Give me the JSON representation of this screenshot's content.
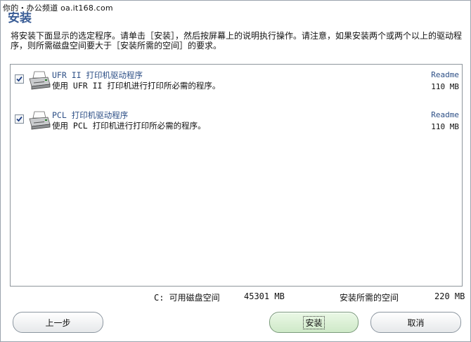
{
  "watermark": "你的・办公频道 oa.it168.com",
  "title": "安装",
  "instruction": "将安装下面显示的选定程序。请单击［安装］，然后按屏幕上的说明执行操作。请注意，如果安装两个或两个以上的驱动程序，则所需磁盘空间要大于［安装所需的空间］的要求。",
  "items": [
    {
      "checked": true,
      "name": "UFR II 打印机驱动程序",
      "description": "使用 UFR II 打印机进行打印所必需的程序。",
      "readme": "Readme",
      "size": "110 MB",
      "icon": "printer-icon"
    },
    {
      "checked": true,
      "name": "PCL 打印机驱动程序",
      "description": "使用 PCL 打印机进行打印所必需的程序。",
      "readme": "Readme",
      "size": "110 MB",
      "icon": "printer-icon"
    }
  ],
  "disk": {
    "available_label": "C: 可用磁盘空间",
    "available_value": "45301 MB",
    "required_label": "安装所需的空间",
    "required_value": "220 MB"
  },
  "buttons": {
    "back": "上一步",
    "install": "安装",
    "cancel": "取消"
  },
  "colors": {
    "title": "#3a5d96",
    "link": "#2d4f86",
    "primary_button": "#cfe9c8"
  }
}
